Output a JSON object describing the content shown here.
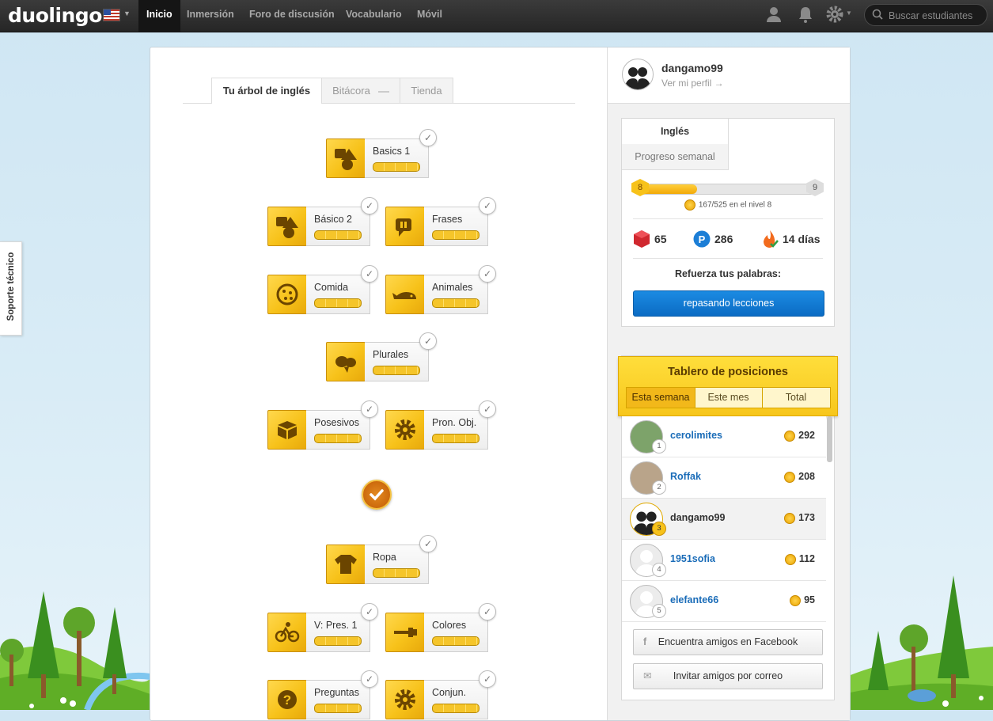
{
  "brand": {
    "logo": "duolingo"
  },
  "nav": {
    "items": [
      {
        "label": "Inicio",
        "active": true
      },
      {
        "label": "Inmersión",
        "active": false
      },
      {
        "label": "Foro de discusión",
        "active": false
      },
      {
        "label": "Vocabulario",
        "active": false
      },
      {
        "label": "Móvil",
        "active": false
      }
    ],
    "search_placeholder": "Buscar estudiantes"
  },
  "support_tab": "Soporte técnico",
  "tree": {
    "tabs": [
      {
        "label": "Tu árbol de inglés",
        "active": true
      },
      {
        "label": "Bitácora",
        "active": false
      },
      {
        "label": "Tienda",
        "active": false
      }
    ],
    "skills": [
      {
        "name": "Basics 1",
        "icon": "faces-icon",
        "completed": true
      },
      {
        "name": "Básico 2",
        "icon": "faces-icon",
        "completed": true
      },
      {
        "name": "Frases",
        "icon": "speech-bubble-icon",
        "completed": true
      },
      {
        "name": "Comida",
        "icon": "pizza-icon",
        "completed": true
      },
      {
        "name": "Animales",
        "icon": "whale-icon",
        "completed": true
      },
      {
        "name": "Plurales",
        "icon": "fish-icon",
        "completed": true
      },
      {
        "name": "Posesivos",
        "icon": "box-icon",
        "completed": true
      },
      {
        "name": "Pron. Obj.",
        "icon": "gear-icon",
        "completed": true
      },
      {
        "name": "Ropa",
        "icon": "shirt-icon",
        "completed": true
      },
      {
        "name": "V: Pres. 1",
        "icon": "bicycle-icon",
        "completed": true
      },
      {
        "name": "Colores",
        "icon": "paintbrush-icon",
        "completed": true
      },
      {
        "name": "Preguntas",
        "icon": "question-icon",
        "completed": true
      },
      {
        "name": "Conjun.",
        "icon": "gear-icon",
        "completed": true
      }
    ],
    "checkpoint_icon": "checkmark-icon"
  },
  "profile": {
    "username": "dangamo99",
    "link": "Ver mi perfil →"
  },
  "stats": {
    "tabs": [
      "Inglés",
      "Progreso semanal"
    ],
    "level_start": "8",
    "level_end": "9",
    "progress_fraction": 0.318,
    "xp_text": "167/525 en el nivel 8",
    "lingots": "65",
    "points": "286",
    "streak": "14 días",
    "reinforce_title": "Refuerza tus palabras:",
    "reinforce_button": "repasando lecciones"
  },
  "leaderboard": {
    "title": "Tablero de posiciones",
    "tabs": [
      {
        "label": "Esta semana",
        "active": true
      },
      {
        "label": "Este mes",
        "active": false
      },
      {
        "label": "Total",
        "active": false
      }
    ],
    "rows": [
      {
        "rank": "1",
        "name": "cerolimites",
        "score": "292",
        "me": false
      },
      {
        "rank": "2",
        "name": "Roffak",
        "score": "208",
        "me": false
      },
      {
        "rank": "3",
        "name": "dangamo99",
        "score": "173",
        "me": true
      },
      {
        "rank": "4",
        "name": "1951sofia",
        "score": "112",
        "me": false
      },
      {
        "rank": "5",
        "name": "elefante66",
        "score": "95",
        "me": false
      }
    ],
    "facebook_button": "Encuentra amigos en Facebook",
    "email_button": "Invitar amigos por correo"
  },
  "colors": {
    "gold": "#f7c21a",
    "blue_button": "#1b8be2",
    "link_blue": "#1a6cb8",
    "nav_bg": "#2e2e2e"
  }
}
